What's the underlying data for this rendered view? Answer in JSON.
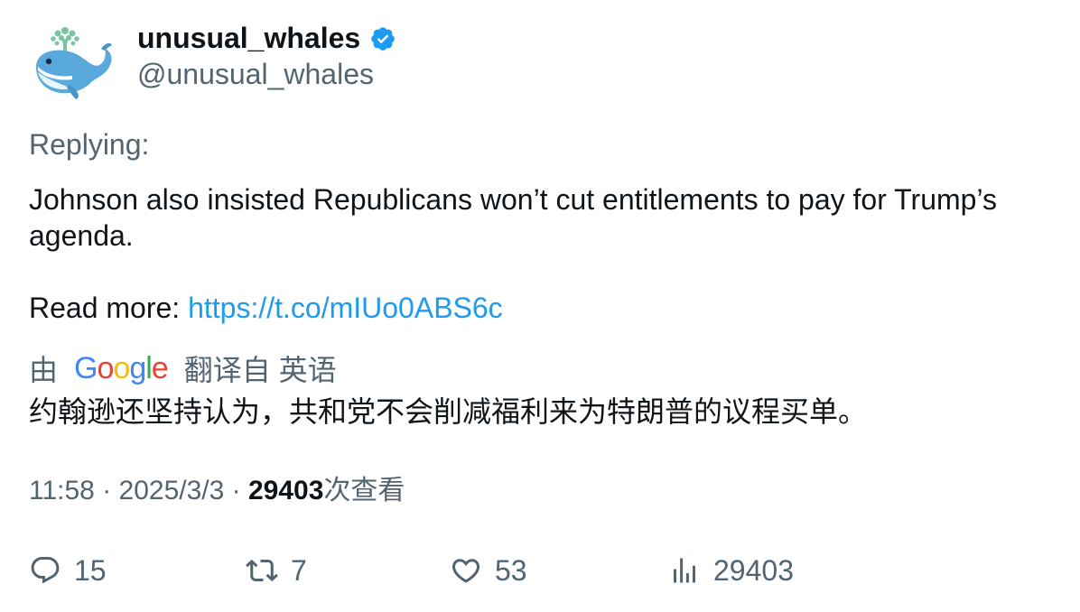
{
  "author": {
    "display_name": "unusual_whales",
    "handle": "@unusual_whales",
    "verified": true,
    "avatar_icon": "whale-logo-icon"
  },
  "tweet": {
    "replying_label": "Replying:",
    "text_line1": "Johnson also insisted Republicans won’t cut entitlements to pay for Trump’s",
    "text_line2": "agenda.",
    "read_more_label": "Read more: ",
    "link": "https://t.co/mIUo0ABS6c"
  },
  "translation": {
    "prefix": "由",
    "provider": "Google",
    "suffix": "翻译自 英语",
    "text": "约翰逊还坚持认为，共和党不会削减福利来为特朗普的议程买单。"
  },
  "meta": {
    "time": "11:58",
    "separator": " · ",
    "date": "2025/3/3",
    "views": "29403",
    "views_label": "次查看"
  },
  "actions": {
    "replies": "15",
    "retweets": "7",
    "likes": "53",
    "views": "29403"
  },
  "colors": {
    "link": "#1d9bf0",
    "muted": "#536471",
    "text": "#0f1419",
    "verified": "#1d9bf0"
  }
}
